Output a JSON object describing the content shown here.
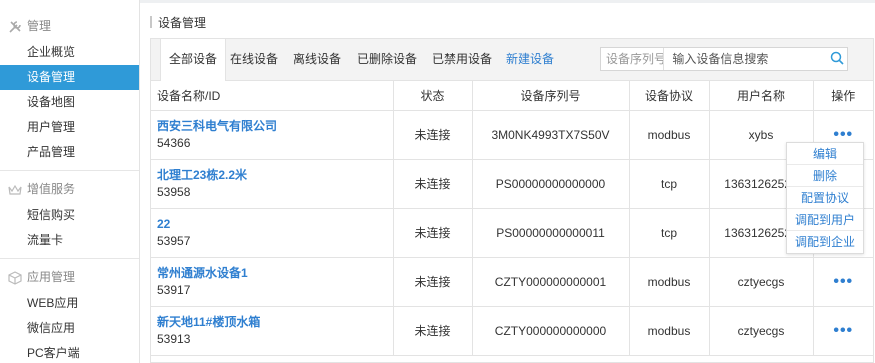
{
  "sidebar": {
    "groups": [
      {
        "title": "管理",
        "icon": "tools-icon",
        "items": [
          "企业概览",
          "设备管理",
          "设备地图",
          "用户管理",
          "产品管理"
        ],
        "active": 1
      },
      {
        "title": "增值服务",
        "icon": "crown-icon",
        "items": [
          "短信购买",
          "流量卡"
        ]
      },
      {
        "title": "应用管理",
        "icon": "cube-icon",
        "items": [
          "WEB应用",
          "微信应用",
          "PC客户端"
        ]
      }
    ]
  },
  "breadcrumb": "设备管理",
  "tabs": [
    "全部设备",
    "在线设备",
    "离线设备",
    "已删除设备",
    "已禁用设备",
    "新建设备"
  ],
  "search": {
    "select_value": "设备序列号",
    "placeholder": "输入设备信息搜索",
    "icon": "search-icon"
  },
  "table": {
    "headers": [
      "设备名称/ID",
      "状态",
      "设备序列号",
      "设备协议",
      "用户名称",
      "操作"
    ],
    "rows": [
      {
        "name": "西安三科电气有限公司",
        "id": "54366",
        "status": "未连接",
        "serial": "3M0NK4993TX7S50V",
        "protocol": "modbus",
        "user": "xybs"
      },
      {
        "name": "北理工23栋2.2米",
        "id": "53958",
        "status": "未连接",
        "serial": "PS00000000000000",
        "protocol": "tcp",
        "user": "13631262529"
      },
      {
        "name": "22",
        "id": "53957",
        "status": "未连接",
        "serial": "PS00000000000011",
        "protocol": "tcp",
        "user": "13631262529"
      },
      {
        "name": "常州通源水设备1",
        "id": "53917",
        "status": "未连接",
        "serial": "CZTY000000000001",
        "protocol": "modbus",
        "user": "cztyecgs"
      },
      {
        "name": "新天地11#楼顶水箱",
        "id": "53913",
        "status": "未连接",
        "serial": "CZTY000000000000",
        "protocol": "modbus",
        "user": "cztyecgs"
      }
    ],
    "action_label": "•••"
  },
  "action_menu": [
    "编辑",
    "删除",
    "配置协议",
    "调配到用户",
    "调配到企业"
  ],
  "colors": {
    "accent": "#2f9ad8",
    "link": "#2f7fd0"
  }
}
